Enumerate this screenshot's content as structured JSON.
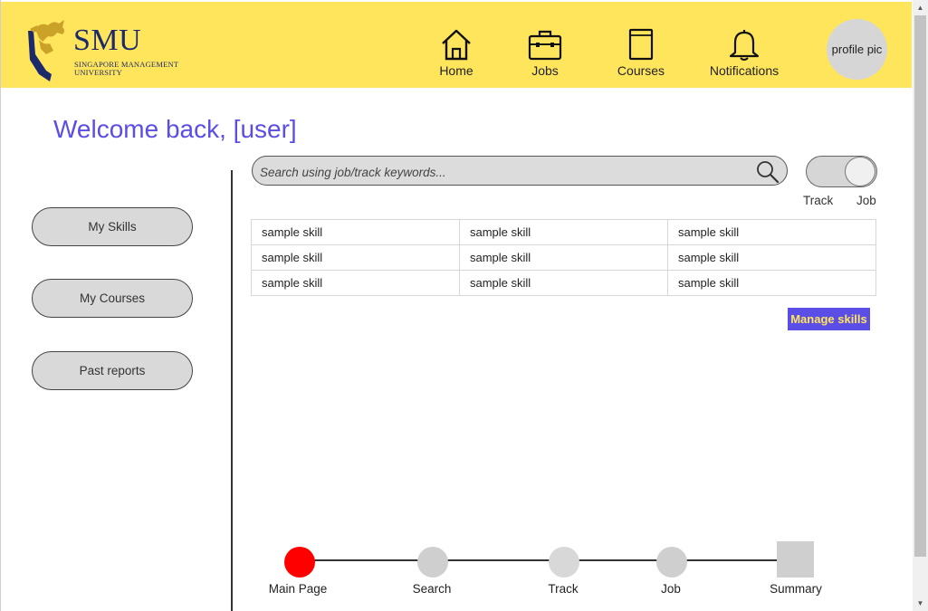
{
  "header": {
    "logo_text": "SMU",
    "logo_subtext_line1": "SINGAPORE MANAGEMENT",
    "logo_subtext_line2": "UNIVERSITY",
    "nav": [
      {
        "label": "Home",
        "icon": "home-icon"
      },
      {
        "label": "Jobs",
        "icon": "briefcase-icon"
      },
      {
        "label": "Courses",
        "icon": "book-icon"
      },
      {
        "label": "Notifications",
        "icon": "bell-icon"
      }
    ],
    "profile_label": "profile pic"
  },
  "welcome": "Welcome back, [user]",
  "sidebar": {
    "items": [
      {
        "label": "My Skills"
      },
      {
        "label": "My Courses"
      },
      {
        "label": "Past reports"
      }
    ]
  },
  "search": {
    "placeholder": "Search using job/track keywords...",
    "value": ""
  },
  "toggle": {
    "left_label": "Track",
    "right_label": "Job",
    "selected": "Job"
  },
  "skills_table": {
    "rows": [
      [
        "sample skill",
        "sample skill",
        "sample skill"
      ],
      [
        "sample skill",
        "sample skill",
        "sample skill"
      ],
      [
        "sample skill",
        "sample skill",
        "sample skill"
      ]
    ]
  },
  "manage_skills_label": "Manage skills",
  "progress": {
    "steps": [
      {
        "label": "Main Page",
        "state": "active"
      },
      {
        "label": "Search",
        "state": "inactive"
      },
      {
        "label": "Track",
        "state": "inactive"
      },
      {
        "label": "Job",
        "state": "inactive"
      },
      {
        "label": "Summary",
        "state": "inactive"
      }
    ]
  },
  "colors": {
    "header_bg": "#ffe55c",
    "accent": "#5b4ee6",
    "active_step": "#ff0000",
    "inactive_step": "#cfcfcf"
  }
}
